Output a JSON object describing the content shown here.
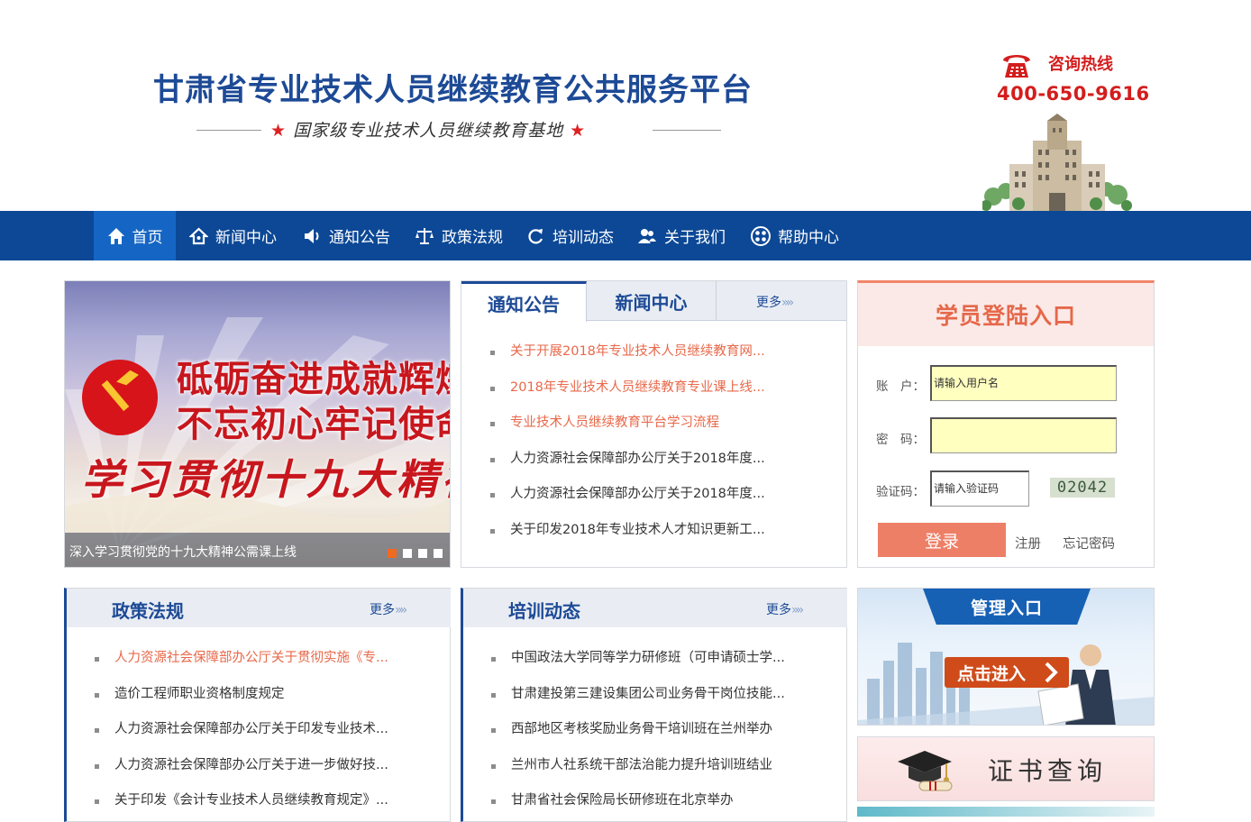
{
  "header": {
    "site_title": "甘肃省专业技术人员继续教育公共服务平台",
    "slogan": "国家级专业技术人员继续教育基地",
    "hotline_label": "咨询热线",
    "hotline_number": "400-650-9616"
  },
  "nav": {
    "items": [
      {
        "label": "首页",
        "icon": "home-icon",
        "active": true
      },
      {
        "label": "新闻中心",
        "icon": "house-outline-icon"
      },
      {
        "label": "通知公告",
        "icon": "speaker-icon"
      },
      {
        "label": "政策法规",
        "icon": "scales-icon"
      },
      {
        "label": "培训动态",
        "icon": "refresh-icon"
      },
      {
        "label": "关于我们",
        "icon": "users-icon"
      },
      {
        "label": "帮助中心",
        "icon": "grid-circle-icon"
      }
    ]
  },
  "banner": {
    "line1": "砥砺奋进成就辉煌",
    "line2": "不忘初心牢记使命",
    "line3": "学习贯彻十九大精神",
    "caption": "深入学习贯彻党的十九大精神公需课上线",
    "active_slide": 1,
    "slide_count": 4
  },
  "notice": {
    "tab_active": "通知公告",
    "tab_other": "新闻中心",
    "more": "更多",
    "items": [
      {
        "text": "关于开展2018年专业技术人员继续教育网...",
        "highlight": true
      },
      {
        "text": "2018年专业技术人员继续教育专业课上线...",
        "highlight": true
      },
      {
        "text": "专业技术人员继续教育平台学习流程",
        "highlight": true
      },
      {
        "text": "人力资源社会保障部办公厅关于2018年度...",
        "highlight": false
      },
      {
        "text": "人力资源社会保障部办公厅关于2018年度...",
        "highlight": false
      },
      {
        "text": "关于印发2018年专业技术人才知识更新工...",
        "highlight": false
      }
    ]
  },
  "login": {
    "title": "学员登陆入口",
    "account_label": "账　户：",
    "account_placeholder": "请输入用户名",
    "password_label": "密　码：",
    "captcha_label": "验证码：",
    "captcha_placeholder": "请输入验证码",
    "captcha_code": "02042",
    "login_button": "登录",
    "register_link": "注册",
    "forgot_link": "忘记密码"
  },
  "policy": {
    "title": "政策法规",
    "more": "更多",
    "items": [
      {
        "text": "人力资源社会保障部办公厅关于贯彻实施《专...",
        "highlight": true
      },
      {
        "text": "造价工程师职业资格制度规定",
        "highlight": false
      },
      {
        "text": "人力资源社会保障部办公厅关于印发专业技术...",
        "highlight": false
      },
      {
        "text": "人力资源社会保障部办公厅关于进一步做好技...",
        "highlight": false
      },
      {
        "text": "关于印发《会计专业技术人员继续教育规定》...",
        "highlight": false
      }
    ]
  },
  "training": {
    "title": "培训动态",
    "more": "更多",
    "items": [
      {
        "text": "中国政法大学同等学力研修班（可申请硕士学..."
      },
      {
        "text": "甘肃建投第三建设集团公司业务骨干岗位技能..."
      },
      {
        "text": "西部地区考核奖励业务骨干培训班在兰州举办"
      },
      {
        "text": "兰州市人社系统干部法治能力提升培训班结业"
      },
      {
        "text": "甘肃省社会保险局长研修班在北京举办"
      }
    ]
  },
  "admin": {
    "title": "管理入口",
    "enter_button": "点击进入"
  },
  "certificate": {
    "label": "证书查询"
  },
  "colors": {
    "nav_bg": "#0c4896",
    "nav_active": "#1566c4",
    "title_blue": "#1d4a96",
    "hotline_red": "#d41d1d",
    "highlight_orange": "#e8684a",
    "login_button": "#ee7f67"
  }
}
